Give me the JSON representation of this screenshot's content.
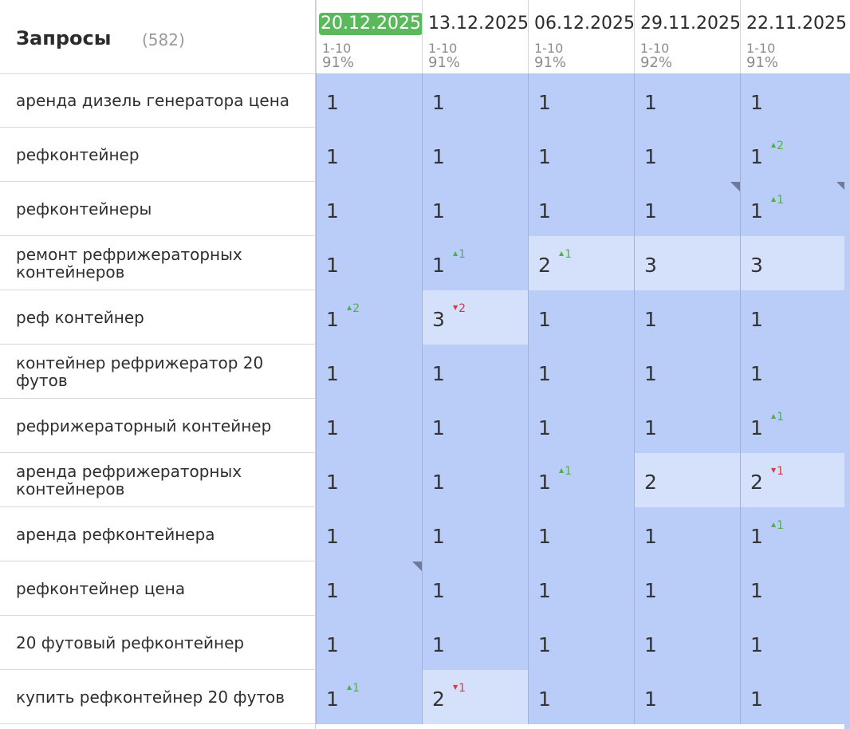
{
  "header": {
    "title": "Запросы",
    "count": "(582)",
    "dates": [
      {
        "date": "20.12.2025",
        "range": "1-10",
        "pct": "91%",
        "active": true
      },
      {
        "date": "13.12.2025",
        "range": "1-10",
        "pct": "91%",
        "active": false
      },
      {
        "date": "06.12.2025",
        "range": "1-10",
        "pct": "91%",
        "active": false
      },
      {
        "date": "29.11.2025",
        "range": "1-10",
        "pct": "92%",
        "active": false
      },
      {
        "date": "22.11.2025",
        "range": "1-10",
        "pct": "91%",
        "active": false
      }
    ]
  },
  "colors": {
    "cell_dark": "#bacdf8",
    "cell_light": "#d5e0fb",
    "up": "#4fae4f",
    "down": "#d23c3c",
    "active_date": "#5cb85c"
  },
  "rows": [
    {
      "query": "аренда дизель генератора цена",
      "cells": [
        {
          "pos": "1"
        },
        {
          "pos": "1"
        },
        {
          "pos": "1"
        },
        {
          "pos": "1"
        },
        {
          "pos": "1"
        }
      ]
    },
    {
      "query": "рефконтейнер",
      "cells": [
        {
          "pos": "1"
        },
        {
          "pos": "1"
        },
        {
          "pos": "1"
        },
        {
          "pos": "1"
        },
        {
          "pos": "1",
          "chg": "2",
          "dir": "up"
        }
      ]
    },
    {
      "query": "рефконтейнеры",
      "cells": [
        {
          "pos": "1"
        },
        {
          "pos": "1"
        },
        {
          "pos": "1"
        },
        {
          "pos": "1",
          "corner": true
        },
        {
          "pos": "1",
          "chg": "1",
          "dir": "up",
          "corner": true
        }
      ]
    },
    {
      "query": "ремонт рефрижераторных контейнеров",
      "cells": [
        {
          "pos": "1"
        },
        {
          "pos": "1",
          "chg": "1",
          "dir": "up"
        },
        {
          "pos": "2",
          "chg": "1",
          "dir": "up",
          "light": true
        },
        {
          "pos": "3",
          "light": true
        },
        {
          "pos": "3",
          "light": true
        }
      ]
    },
    {
      "query": "реф контейнер",
      "cells": [
        {
          "pos": "1",
          "chg": "2",
          "dir": "up"
        },
        {
          "pos": "3",
          "chg": "2",
          "dir": "down",
          "light": true
        },
        {
          "pos": "1"
        },
        {
          "pos": "1"
        },
        {
          "pos": "1"
        }
      ]
    },
    {
      "query": "контейнер рефрижератор 20 футов",
      "cells": [
        {
          "pos": "1"
        },
        {
          "pos": "1"
        },
        {
          "pos": "1"
        },
        {
          "pos": "1"
        },
        {
          "pos": "1"
        }
      ]
    },
    {
      "query": "рефрижераторный контейнер",
      "cells": [
        {
          "pos": "1"
        },
        {
          "pos": "1"
        },
        {
          "pos": "1"
        },
        {
          "pos": "1"
        },
        {
          "pos": "1",
          "chg": "1",
          "dir": "up"
        }
      ]
    },
    {
      "query": "аренда рефрижераторных контейнеров",
      "cells": [
        {
          "pos": "1"
        },
        {
          "pos": "1"
        },
        {
          "pos": "1",
          "chg": "1",
          "dir": "up"
        },
        {
          "pos": "2",
          "light": true
        },
        {
          "pos": "2",
          "chg": "1",
          "dir": "down",
          "light": true
        }
      ]
    },
    {
      "query": "аренда рефконтейнера",
      "cells": [
        {
          "pos": "1"
        },
        {
          "pos": "1"
        },
        {
          "pos": "1"
        },
        {
          "pos": "1"
        },
        {
          "pos": "1",
          "chg": "1",
          "dir": "up"
        }
      ]
    },
    {
      "query": "рефконтейнер цена",
      "cells": [
        {
          "pos": "1",
          "corner": true
        },
        {
          "pos": "1"
        },
        {
          "pos": "1"
        },
        {
          "pos": "1"
        },
        {
          "pos": "1"
        }
      ]
    },
    {
      "query": "20 футовый рефконтейнер",
      "cells": [
        {
          "pos": "1"
        },
        {
          "pos": "1"
        },
        {
          "pos": "1"
        },
        {
          "pos": "1"
        },
        {
          "pos": "1"
        }
      ]
    },
    {
      "query": "купить рефконтейнер 20 футов",
      "cells": [
        {
          "pos": "1",
          "chg": "1",
          "dir": "up"
        },
        {
          "pos": "2",
          "chg": "1",
          "dir": "down",
          "light": true
        },
        {
          "pos": "1"
        },
        {
          "pos": "1"
        },
        {
          "pos": "1"
        }
      ]
    }
  ]
}
